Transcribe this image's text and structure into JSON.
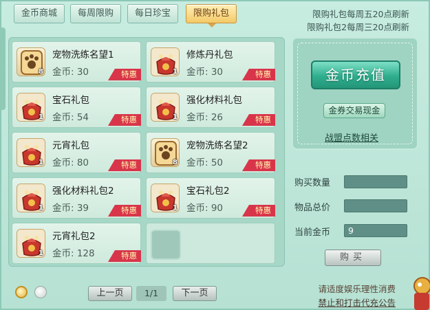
{
  "tabs": [
    {
      "label": "金币商城",
      "active": false
    },
    {
      "label": "每周限购",
      "active": false
    },
    {
      "label": "每日珍宝",
      "active": false
    },
    {
      "label": "限购礼包",
      "active": true
    }
  ],
  "notices": [
    "限购礼包每周五20点刷新",
    "限购礼包2每周三20点刷新"
  ],
  "items": [
    {
      "name": "宠物洗练名望1",
      "price": "金币: 30",
      "count": "8",
      "tag": "特惠",
      "icon": "paw-token-icon"
    },
    {
      "name": "修炼丹礼包",
      "price": "金币: 30",
      "count": "1",
      "tag": "特惠",
      "icon": "gift-bag-icon"
    },
    {
      "name": "宝石礼包",
      "price": "金币: 54",
      "count": "1",
      "tag": "特惠",
      "icon": "gift-bag-icon"
    },
    {
      "name": "强化材料礼包",
      "price": "金币: 26",
      "count": "1",
      "tag": "特惠",
      "icon": "gift-bag-icon"
    },
    {
      "name": "元宵礼包",
      "price": "金币: 80",
      "count": "1",
      "tag": "特惠",
      "icon": "gift-bag-icon"
    },
    {
      "name": "宠物洗练名望2",
      "price": "金币: 50",
      "count": "8",
      "tag": "特惠",
      "icon": "paw-token-icon"
    },
    {
      "name": "强化材料礼包2",
      "price": "金币: 39",
      "count": "1",
      "tag": "特惠",
      "icon": "gift-bag-icon"
    },
    {
      "name": "宝石礼包2",
      "price": "金币: 90",
      "count": "1",
      "tag": "特惠",
      "icon": "gift-bag-icon"
    },
    {
      "name": "元宵礼包2",
      "price": "金币: 128",
      "count": "1",
      "tag": "特惠",
      "icon": "gift-bag-icon"
    }
  ],
  "pager": {
    "prev": "上一页",
    "indicator": "1/1",
    "next": "下一页"
  },
  "recharge": {
    "button": "金币充值",
    "exchange": "金券交易现金",
    "league_link": "战盟点数相关"
  },
  "form": {
    "quantity_label": "购买数量",
    "quantity_value": "",
    "total_label": "物品总价",
    "total_value": "",
    "balance_label": "当前金币",
    "balance_value": "9"
  },
  "buy_button": "购买",
  "footer": {
    "line1": "请适度娱乐理性消费",
    "line2": "禁止和打击代充公告"
  },
  "colors": {
    "accent": "#2fae8e",
    "sale": "#d8354a",
    "active_tab": "#f3c967"
  }
}
